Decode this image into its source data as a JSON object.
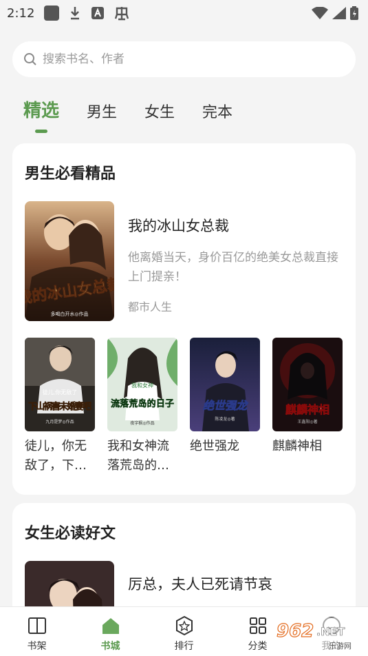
{
  "status_bar": {
    "time": "2:12"
  },
  "search": {
    "placeholder": "搜索书名、作者"
  },
  "tabs": [
    {
      "label": "精选",
      "active": true
    },
    {
      "label": "男生",
      "active": false
    },
    {
      "label": "女生",
      "active": false
    },
    {
      "label": "完本",
      "active": false
    }
  ],
  "section_male": {
    "title": "男生必看精品",
    "featured": {
      "title": "我的冰山女总裁",
      "description": "他离婚当天，身价百亿的绝美女总裁直接上门提亲！",
      "category": "都市人生",
      "cover_text": "我的冰山女总裁",
      "cover_author": "多喝白开水◎作品"
    },
    "books": [
      {
        "title": "徒儿，你无敌了，下…",
        "cover_text": "下山祸害未婚妻吧",
        "cover_top": "徒儿,你无敌了",
        "cover_author": "九月是梦◎作品"
      },
      {
        "title": "我和女神流落荒岛的…",
        "cover_text": "流落荒岛的日子",
        "cover_top": "我和女神",
        "cover_author": "夜宇枫◎作品"
      },
      {
        "title": "绝世强龙",
        "cover_text": "绝世强龙",
        "cover_top": "",
        "cover_author": "陈凌龙◎著"
      },
      {
        "title": "麒麟神相",
        "cover_text": "麒麟神相",
        "cover_top": "",
        "cover_author": "王鑫阳◎著"
      }
    ]
  },
  "section_female": {
    "title": "女生必读好文",
    "featured": {
      "title": "厉总，夫人已死请节哀"
    }
  },
  "bottom_nav": [
    {
      "label": "书架",
      "icon": "book-open-icon",
      "active": false
    },
    {
      "label": "书城",
      "icon": "house-icon",
      "active": true
    },
    {
      "label": "排行",
      "icon": "star-badge-icon",
      "active": false
    },
    {
      "label": "分类",
      "icon": "grid-icon",
      "active": false
    },
    {
      "label": "我的",
      "icon": "smile-icon",
      "active": false
    }
  ],
  "watermark": {
    "number": "962",
    "suffix": ".NET",
    "sub": "乐游网"
  },
  "colors": {
    "accent": "#5b9a4f",
    "background": "#f4f4f4",
    "card": "#ffffff",
    "muted_text": "#999999"
  }
}
